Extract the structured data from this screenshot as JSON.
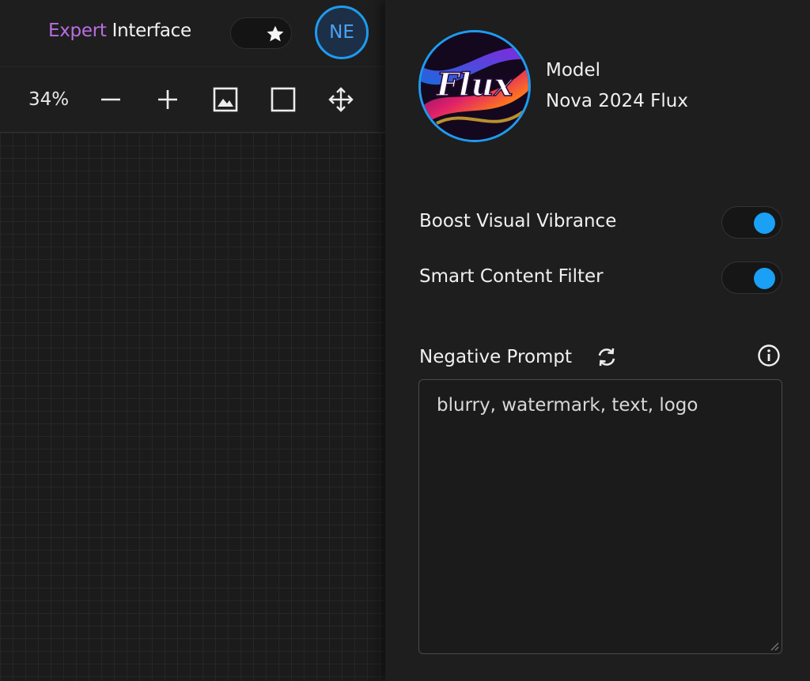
{
  "header": {
    "brand_part1": "Expert",
    "brand_part2": "Interface",
    "avatar_initials": "NE",
    "favorite_icon": "star-icon"
  },
  "toolbar": {
    "zoom": "34%",
    "buttons": [
      {
        "name": "zoom-out",
        "icon": "minus-icon"
      },
      {
        "name": "zoom-in",
        "icon": "plus-icon"
      },
      {
        "name": "image",
        "icon": "image-icon"
      },
      {
        "name": "frame",
        "icon": "square-icon"
      },
      {
        "name": "pan",
        "icon": "move-icon"
      }
    ]
  },
  "panel": {
    "model_label": "Model",
    "model_name": "Nova 2024 Flux",
    "model_thumb_text": "Flux",
    "settings": [
      {
        "label": "Boost Visual Vibrance",
        "enabled": true
      },
      {
        "label": "Smart Content Filter",
        "enabled": true
      }
    ],
    "negative_prompt": {
      "label": "Negative Prompt",
      "value": "blurry, watermark, text, logo"
    }
  },
  "colors": {
    "accent": "#1aa0f5",
    "brand_purple": "#b86fe0",
    "background": "#1a1a1a"
  }
}
